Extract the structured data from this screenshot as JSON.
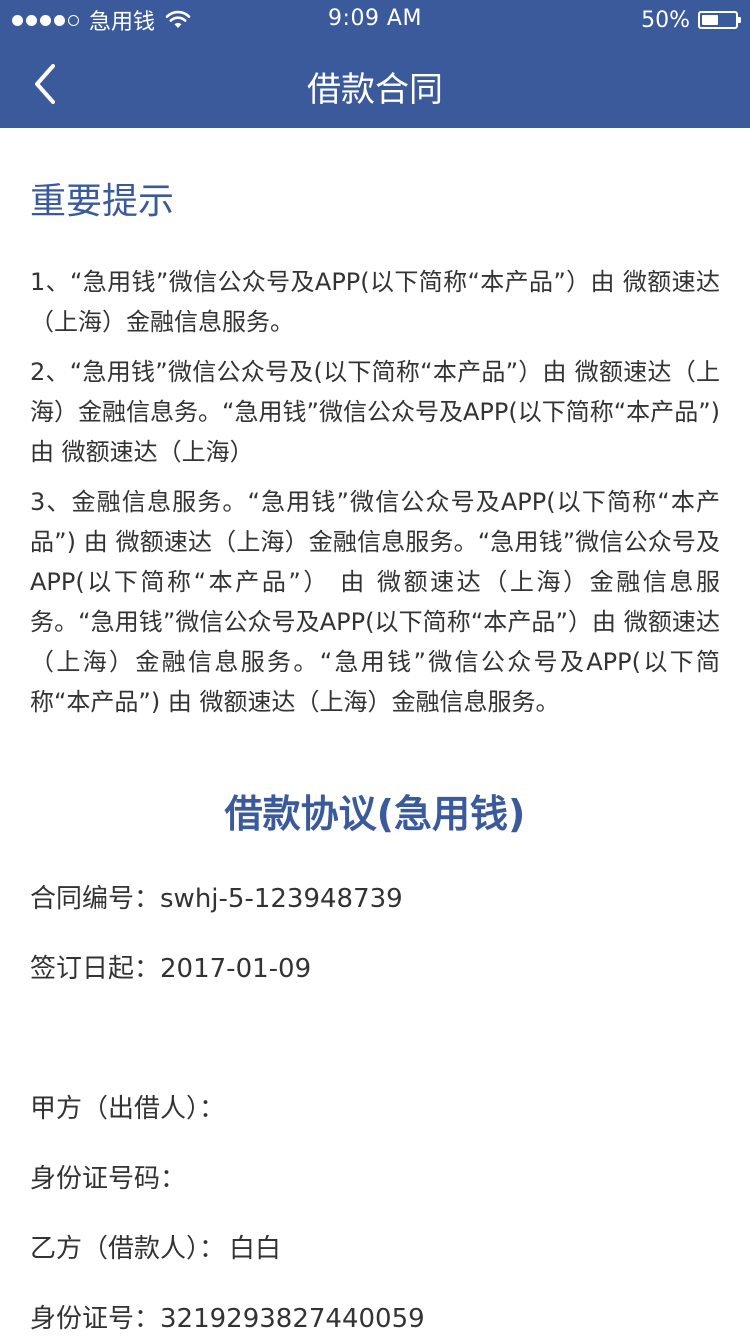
{
  "status_bar": {
    "carrier": "急用钱",
    "time": "9:09 AM",
    "battery_percent": "50%",
    "battery_level": 0.5,
    "signal_bars_filled": 4,
    "signal_bars_total": 5
  },
  "nav": {
    "title": "借款合同",
    "back_icon": "chevron-left-icon"
  },
  "notice": {
    "heading": "重要提示",
    "items": [
      "1、“急用钱”微信公众号及APP(以下简称“本产品”）由 微额速达（上海）金融信息服务。",
      "2、“急用钱”微信公众号及(以下简称“本产品”）由 微额速达（上海）金融信息务。“急用钱”微信公众号及APP(以下简称“本产品”) 由 微额速达（上海）",
      "3、金融信息服务。“急用钱”微信公众号及APP(以下简称“本产品”) 由 微额速达（上海）金融信息服务。“急用钱”微信公众号及APP(以下简称“本产品”） 由 微额速达（上海）金融信息服务。“急用钱”微信公众号及APP(以下简称“本产品”）由 微额速达（上海）金融信息服务。“急用钱”微信公众号及APP(以下简称“本产品”) 由 微额速达（上海）金融信息服务。"
    ]
  },
  "agreement": {
    "title": "借款协议(急用钱)",
    "contract_no_label": "合同编号：",
    "contract_no": "swhj-5-123948739",
    "sign_date_label": "签订日起：",
    "sign_date": "2017-01-09",
    "lender_label": "甲方（出借人）：",
    "lender_name": "",
    "lender_id_label": "身份证号码：",
    "lender_id": "",
    "borrower_label": "乙方（借款人）：",
    "borrower_name": "白白",
    "borrower_id_label": "身份证号：",
    "borrower_id": "321929382744​0059"
  },
  "colors": {
    "header_bg": "#3a5a9c",
    "accent": "#3a5a9c",
    "text": "#333333"
  }
}
